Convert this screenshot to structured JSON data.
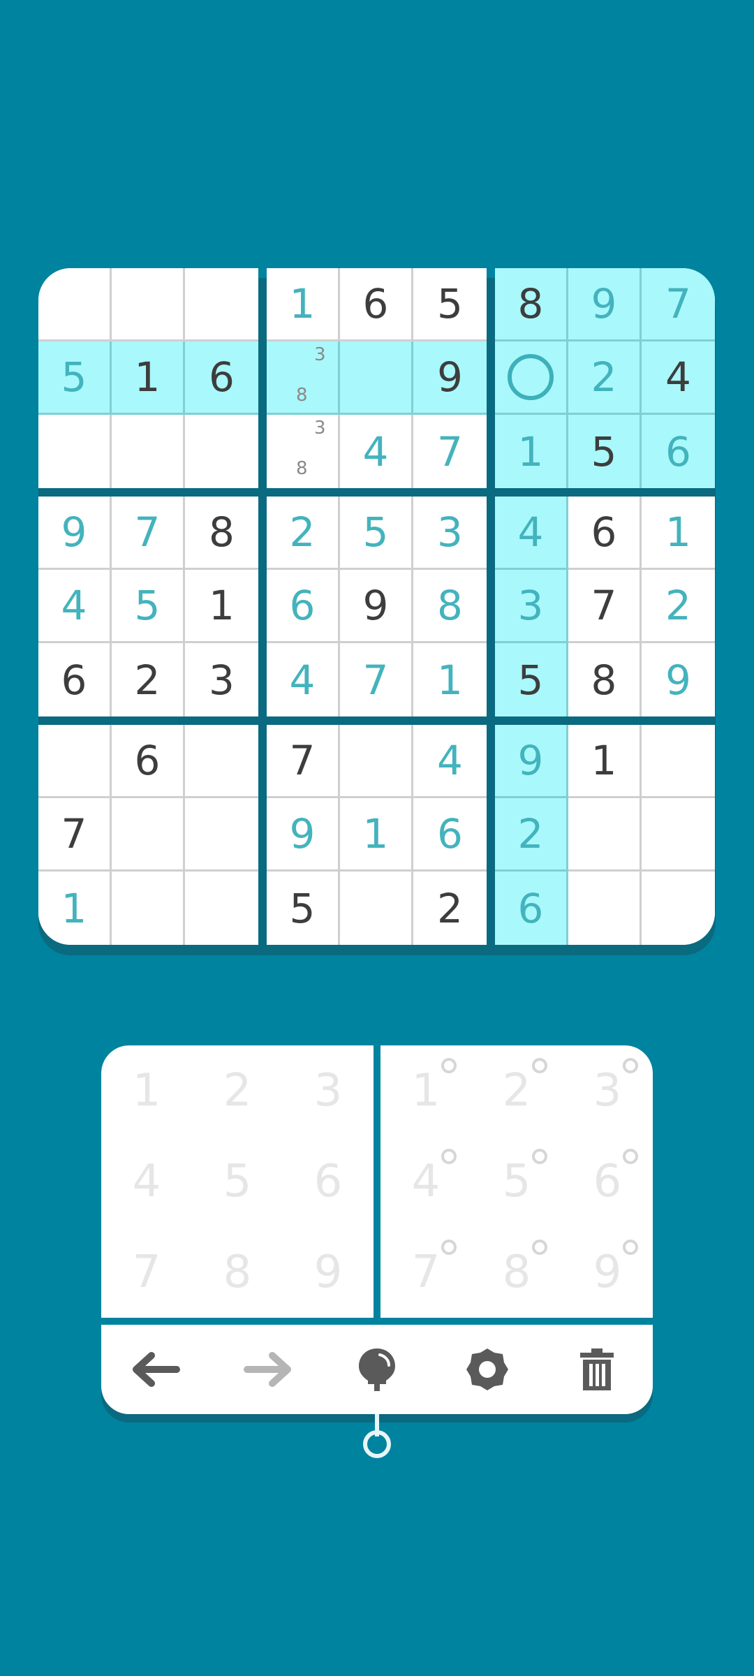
{
  "board": {
    "rows": [
      [
        {
          "v": "",
          "t": "empty"
        },
        {
          "v": "",
          "t": "empty"
        },
        {
          "v": "",
          "t": "empty"
        },
        {
          "v": "1",
          "t": "user"
        },
        {
          "v": "6",
          "t": "given"
        },
        {
          "v": "5",
          "t": "given"
        },
        {
          "v": "8",
          "t": "given"
        },
        {
          "v": "9",
          "t": "user"
        },
        {
          "v": "7",
          "t": "user"
        }
      ],
      [
        {
          "v": "5",
          "t": "user"
        },
        {
          "v": "1",
          "t": "given"
        },
        {
          "v": "6",
          "t": "given"
        },
        {
          "v": "",
          "t": "pencil",
          "notes": [
            "3",
            "8"
          ]
        },
        {
          "v": "",
          "t": "empty"
        },
        {
          "v": "9",
          "t": "given"
        },
        {
          "v": "",
          "t": "selected"
        },
        {
          "v": "2",
          "t": "user"
        },
        {
          "v": "4",
          "t": "given"
        }
      ],
      [
        {
          "v": "",
          "t": "empty"
        },
        {
          "v": "",
          "t": "empty"
        },
        {
          "v": "",
          "t": "empty"
        },
        {
          "v": "",
          "t": "pencil",
          "notes": [
            "3",
            "8"
          ]
        },
        {
          "v": "4",
          "t": "user"
        },
        {
          "v": "7",
          "t": "user"
        },
        {
          "v": "1",
          "t": "user"
        },
        {
          "v": "5",
          "t": "given"
        },
        {
          "v": "6",
          "t": "user"
        }
      ],
      [
        {
          "v": "9",
          "t": "user"
        },
        {
          "v": "7",
          "t": "user"
        },
        {
          "v": "8",
          "t": "given"
        },
        {
          "v": "2",
          "t": "user"
        },
        {
          "v": "5",
          "t": "user"
        },
        {
          "v": "3",
          "t": "user"
        },
        {
          "v": "4",
          "t": "user"
        },
        {
          "v": "6",
          "t": "given"
        },
        {
          "v": "1",
          "t": "user"
        }
      ],
      [
        {
          "v": "4",
          "t": "user"
        },
        {
          "v": "5",
          "t": "user"
        },
        {
          "v": "1",
          "t": "given"
        },
        {
          "v": "6",
          "t": "user"
        },
        {
          "v": "9",
          "t": "given"
        },
        {
          "v": "8",
          "t": "user"
        },
        {
          "v": "3",
          "t": "user"
        },
        {
          "v": "7",
          "t": "given"
        },
        {
          "v": "2",
          "t": "user"
        }
      ],
      [
        {
          "v": "6",
          "t": "given"
        },
        {
          "v": "2",
          "t": "given"
        },
        {
          "v": "3",
          "t": "given"
        },
        {
          "v": "4",
          "t": "user"
        },
        {
          "v": "7",
          "t": "user"
        },
        {
          "v": "1",
          "t": "user"
        },
        {
          "v": "5",
          "t": "given"
        },
        {
          "v": "8",
          "t": "given"
        },
        {
          "v": "9",
          "t": "user"
        }
      ],
      [
        {
          "v": "",
          "t": "empty"
        },
        {
          "v": "6",
          "t": "given"
        },
        {
          "v": "",
          "t": "empty"
        },
        {
          "v": "7",
          "t": "given"
        },
        {
          "v": "",
          "t": "empty"
        },
        {
          "v": "4",
          "t": "user"
        },
        {
          "v": "9",
          "t": "user"
        },
        {
          "v": "1",
          "t": "given"
        },
        {
          "v": "",
          "t": "empty"
        }
      ],
      [
        {
          "v": "7",
          "t": "given"
        },
        {
          "v": "",
          "t": "empty"
        },
        {
          "v": "",
          "t": "empty"
        },
        {
          "v": "9",
          "t": "user"
        },
        {
          "v": "1",
          "t": "user"
        },
        {
          "v": "6",
          "t": "user"
        },
        {
          "v": "2",
          "t": "user"
        },
        {
          "v": "",
          "t": "empty"
        },
        {
          "v": "",
          "t": "empty"
        }
      ],
      [
        {
          "v": "1",
          "t": "user"
        },
        {
          "v": "",
          "t": "empty"
        },
        {
          "v": "",
          "t": "empty"
        },
        {
          "v": "5",
          "t": "given"
        },
        {
          "v": "",
          "t": "empty"
        },
        {
          "v": "2",
          "t": "given"
        },
        {
          "v": "6",
          "t": "user"
        },
        {
          "v": "",
          "t": "empty"
        },
        {
          "v": "",
          "t": "empty"
        }
      ]
    ],
    "selected": {
      "row": 2,
      "col": 7
    },
    "highlight_row": 2,
    "highlight_col": 7,
    "highlight_box": 3
  },
  "number_pad": {
    "digits": [
      "1",
      "2",
      "3",
      "4",
      "5",
      "6",
      "7",
      "8",
      "9"
    ]
  },
  "pencil_pad": {
    "digits": [
      "1",
      "2",
      "3",
      "4",
      "5",
      "6",
      "7",
      "8",
      "9"
    ]
  },
  "toolbar": {
    "items": [
      {
        "name": "undo-icon",
        "enabled": true
      },
      {
        "name": "redo-icon",
        "enabled": false
      },
      {
        "name": "hint-bulb-icon",
        "enabled": true
      },
      {
        "name": "settings-gear-icon",
        "enabled": true
      },
      {
        "name": "delete-trash-icon",
        "enabled": true
      }
    ]
  },
  "colors": {
    "background": "#00839f",
    "highlight": "#a9f8fb",
    "given_digit": "#3d3d3d",
    "user_digit": "#43b3bd",
    "pad_digit": "#e6e6e6"
  }
}
